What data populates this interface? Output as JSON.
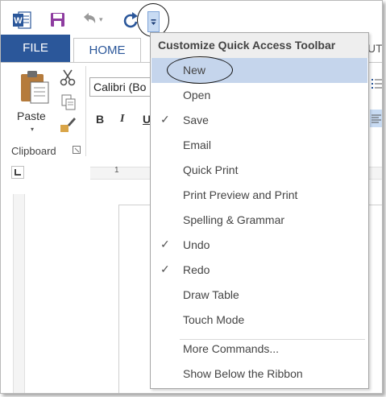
{
  "qat": {
    "app_icon": "word-icon",
    "save_icon": "save-icon",
    "undo_icon": "undo-icon",
    "undo_dropdown": "▾",
    "redo_icon": "redo-icon",
    "customize_icon": "customize-dropdown-icon"
  },
  "tabs": {
    "file": "FILE",
    "home": "HOME",
    "partial_right": "UT"
  },
  "ribbon": {
    "paste_label": "Paste",
    "paste_dropdown": "▾",
    "clipboard_label": "Clipboard",
    "font_name": "Calibri (Bo",
    "bold": "B",
    "italic": "I",
    "underline": "U"
  },
  "ruler": {
    "number": "1"
  },
  "menu": {
    "header": "Customize Quick Access Toolbar",
    "items": [
      {
        "label": "New",
        "checked": false,
        "highlighted": true
      },
      {
        "label": "Open",
        "checked": false
      },
      {
        "label": "Save",
        "checked": true
      },
      {
        "label": "Email",
        "checked": false
      },
      {
        "label": "Quick Print",
        "checked": false
      },
      {
        "label": "Print Preview and Print",
        "checked": false
      },
      {
        "label": "Spelling & Grammar",
        "checked": false
      },
      {
        "label": "Undo",
        "checked": true
      },
      {
        "label": "Redo",
        "checked": true
      },
      {
        "label": "Draw Table",
        "checked": false
      },
      {
        "label": "Touch Mode",
        "checked": false
      }
    ],
    "more_commands": "More Commands...",
    "show_below": "Show Below the Ribbon",
    "check_glyph": "✓"
  },
  "colors": {
    "file_tab": "#2b579a",
    "highlight": "#c5d5ec",
    "save_icon": "#8e3ca0"
  }
}
